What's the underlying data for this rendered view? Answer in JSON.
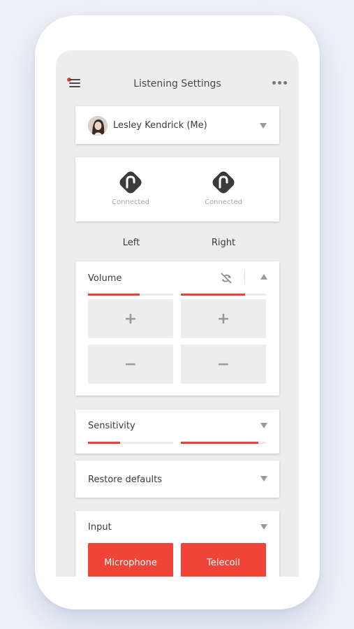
{
  "header": {
    "title": "Listening Settings",
    "menu_icon": "hamburger-menu-icon",
    "notification_dot_color": "#e8403a",
    "more_icon": "more-horizontal-icon"
  },
  "user": {
    "name": "Lesley Kendrick (Me)",
    "avatar_icon": "user-avatar"
  },
  "devices": {
    "left": {
      "status": "Connected",
      "icon": "hearing-aid-icon"
    },
    "right": {
      "status": "Connected",
      "icon": "hearing-aid-icon"
    }
  },
  "sides": {
    "left_label": "Left",
    "right_label": "Right"
  },
  "volume": {
    "title": "Volume",
    "sync_icon": "unlink-sync-icon",
    "left_level": 0.61,
    "right_level": 0.75,
    "increase_label": "+",
    "decrease_label": "−"
  },
  "sensitivity": {
    "title": "Sensitivity",
    "left_level": 0.38,
    "right_level": 0.91
  },
  "restore": {
    "title": "Restore defaults"
  },
  "input": {
    "title": "Input",
    "options": [
      "Microphone",
      "Telecoil"
    ]
  },
  "colors": {
    "accent": "#e8403a",
    "button_red": "#f04438",
    "screen_bg": "#ededed"
  }
}
